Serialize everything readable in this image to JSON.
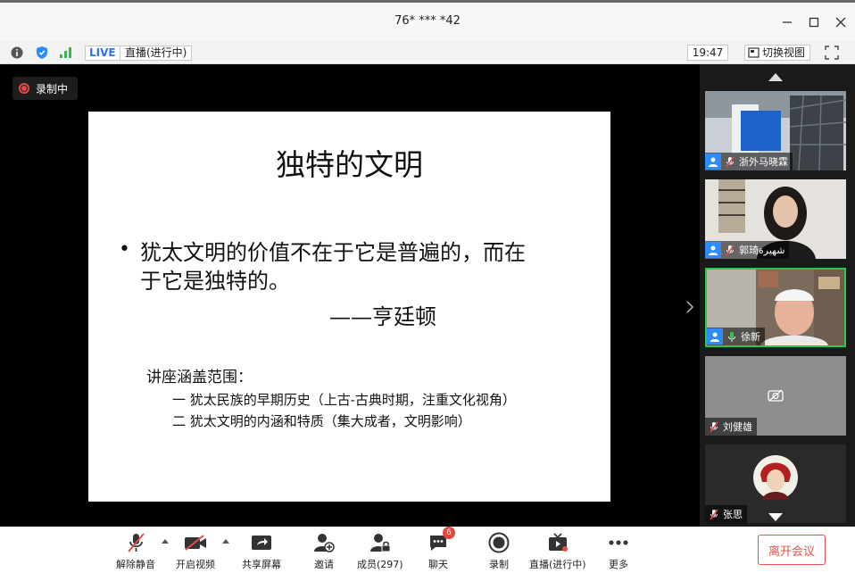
{
  "window": {
    "title": "76* *** *42"
  },
  "infobar": {
    "live_label": "LIVE",
    "live_status": "直播(进行中)",
    "time": "19:47",
    "switch_view": "切换视图"
  },
  "recording_badge": "录制中",
  "slide": {
    "title": "独特的文明",
    "bullet": "•",
    "quote_line1": "犹太文明的价值不在于它是普遍的，而在",
    "quote_line2": "于它是独特的。",
    "author": "——亨廷顿",
    "scope_heading": "讲座涵盖范围：",
    "scope_items": [
      "一 犹太民族的早期历史（上古-古典时期，注重文化视角）",
      "二 犹太文明的内涵和特质（集大成者，文明影响）"
    ]
  },
  "participants": [
    {
      "name": "浙外马晓霖"
    },
    {
      "name": "郭琦شهيرة"
    },
    {
      "name": "徐新"
    },
    {
      "name": "刘健雄"
    },
    {
      "name": "张思"
    }
  ],
  "toolbar": {
    "unmute": "解除静音",
    "start_video": "开启视频",
    "share_screen": "共享屏幕",
    "invite": "邀请",
    "members": "成员(297)",
    "chat": "聊天",
    "chat_badge": "6",
    "record": "录制",
    "live": "直播(进行中)",
    "more": "更多",
    "leave": "离开会议"
  },
  "colors": {
    "accent": "#2d8cff",
    "recording": "#e84a4a",
    "leave": "#e2554c",
    "active_speaker": "#28c94a"
  }
}
